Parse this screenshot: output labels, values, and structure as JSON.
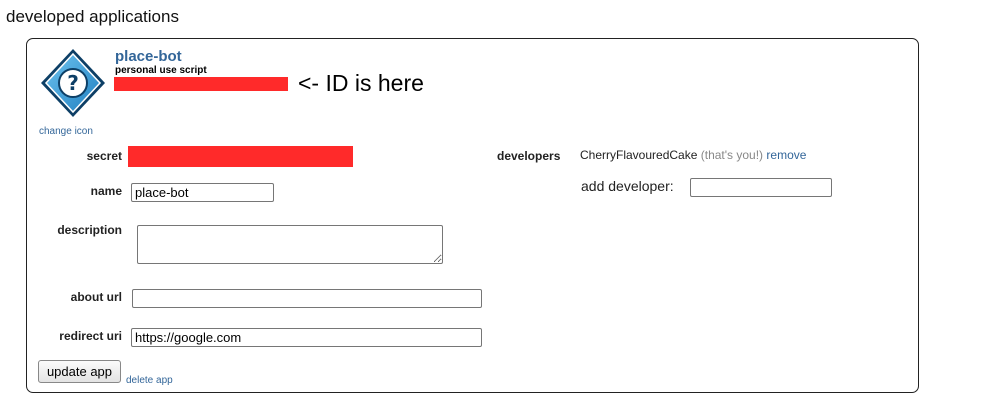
{
  "section": {
    "title": "developed applications"
  },
  "app": {
    "name": "place-bot",
    "type": "personal use script",
    "id_annotation": "<- ID is here",
    "change_icon_label": "change icon",
    "icon": "question-mark-diamond-icon",
    "redaction_color": "#ff2a2a"
  },
  "form": {
    "secret_label": "secret",
    "name_label": "name",
    "name_value": "place-bot",
    "description_label": "description",
    "description_value": "",
    "about_url_label": "about url",
    "about_url_value": "",
    "redirect_uri_label": "redirect uri",
    "redirect_uri_value": "https://google.com"
  },
  "developers": {
    "label": "developers",
    "name": "CherryFlavouredCake",
    "you_note": "(that's you!)",
    "remove_label": "remove",
    "add_label": "add developer:",
    "add_value": ""
  },
  "actions": {
    "update_label": "update app",
    "delete_label": "delete app"
  },
  "colors": {
    "link": "#336699",
    "app_name": "#336699"
  }
}
